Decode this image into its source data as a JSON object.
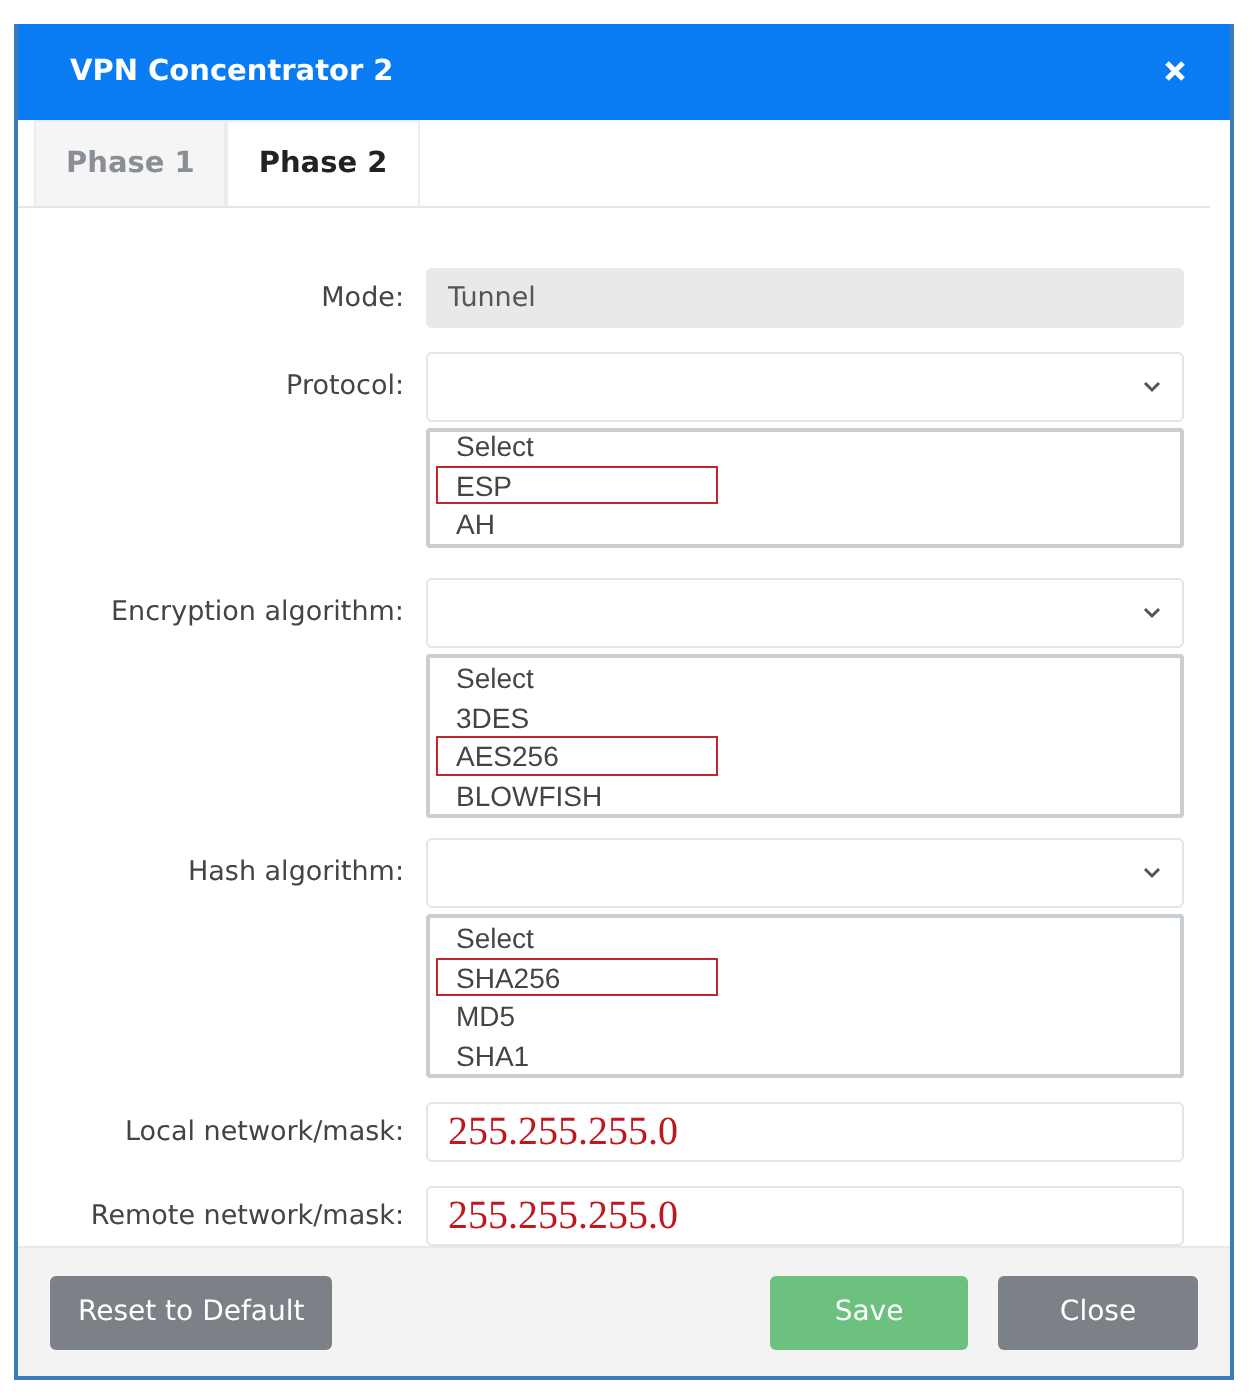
{
  "dialog": {
    "title": "VPN Concentrator 2"
  },
  "tabs": [
    {
      "label": "Phase 1",
      "selected": false
    },
    {
      "label": "Phase 2",
      "selected": true
    }
  ],
  "fields": [
    {
      "kind": "readonly",
      "label": "Mode:",
      "value": "Tunnel"
    },
    {
      "kind": "select",
      "label": "Protocol:",
      "options": [
        {
          "label": "Select",
          "highlighted": false
        },
        {
          "label": "ESP",
          "highlighted": true
        },
        {
          "label": "AH",
          "highlighted": false
        }
      ]
    },
    {
      "kind": "select",
      "label": "Encryption algorithm:",
      "options": [
        {
          "label": "Select",
          "highlighted": false
        },
        {
          "label": "3DES",
          "highlighted": false
        },
        {
          "label": "AES256",
          "highlighted": true
        },
        {
          "label": "BLOWFISH",
          "highlighted": false
        }
      ]
    },
    {
      "kind": "select",
      "label": "Hash algorithm:",
      "options": [
        {
          "label": "Select",
          "highlighted": false
        },
        {
          "label": "SHA256",
          "highlighted": true
        },
        {
          "label": "MD5",
          "highlighted": false
        },
        {
          "label": "SHA1",
          "highlighted": false
        }
      ]
    },
    {
      "kind": "text",
      "label": "Local network/mask:",
      "value": "255.255.255.0"
    },
    {
      "kind": "text",
      "label": "Remote network/mask:",
      "value": "255.255.255.0"
    }
  ],
  "buttons": [
    {
      "label": "Reset to Default",
      "kind": "secondary"
    },
    {
      "label": "Save",
      "kind": "primary"
    },
    {
      "label": "Close",
      "kind": "secondary"
    }
  ]
}
